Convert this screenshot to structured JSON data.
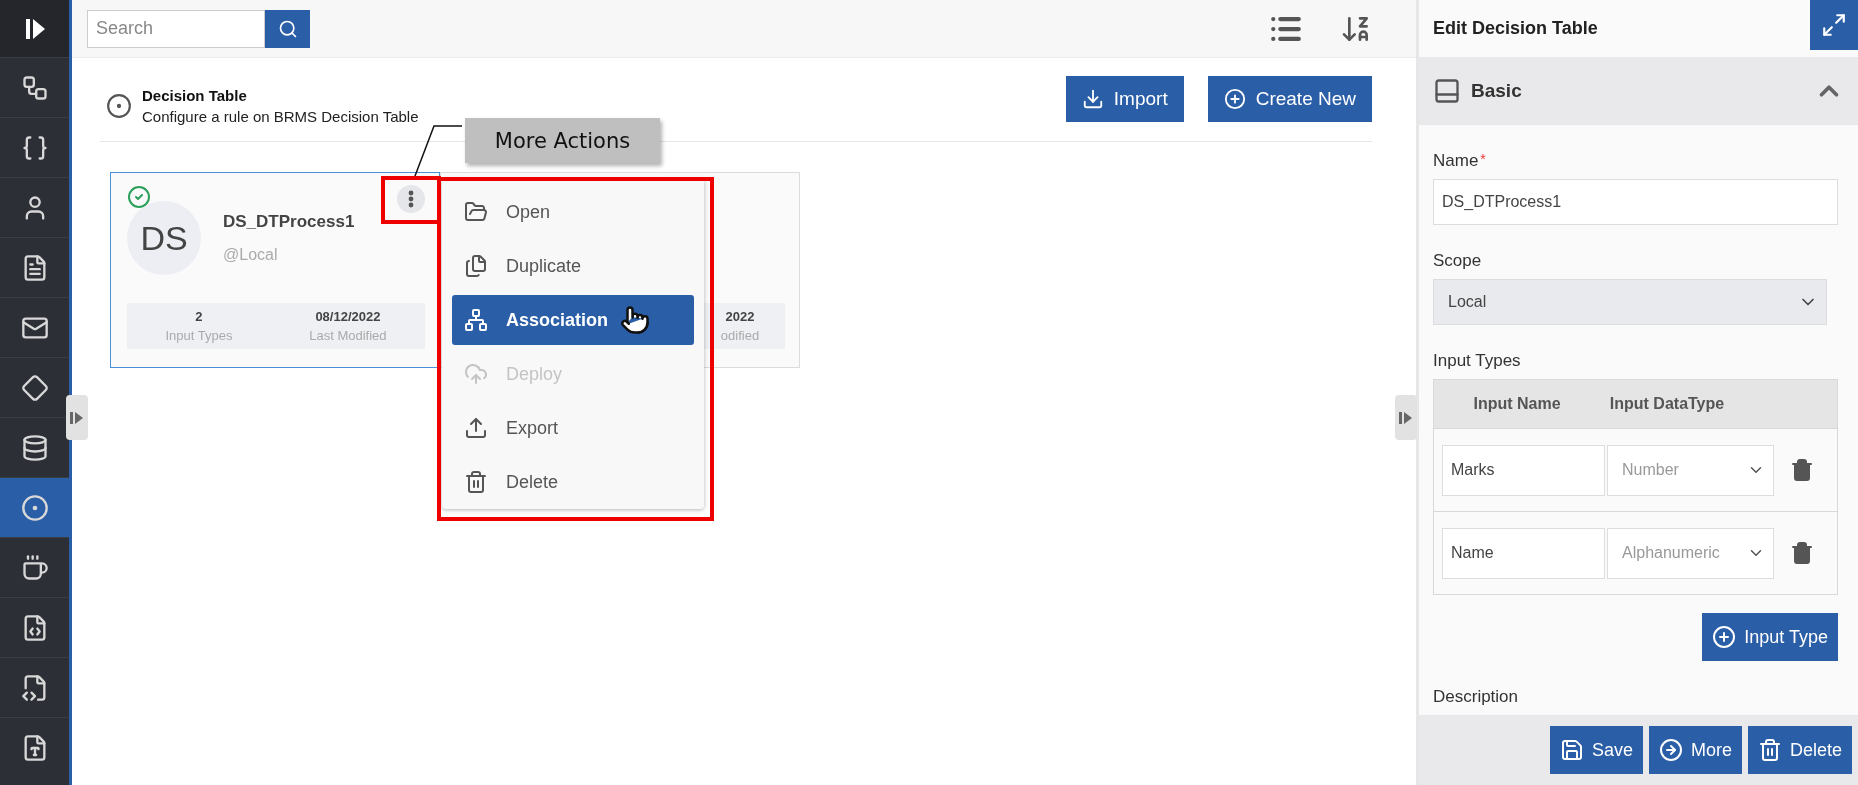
{
  "sidebar": {
    "items": [
      {
        "selected": false
      },
      {
        "selected": false
      },
      {
        "selected": false
      },
      {
        "selected": false
      },
      {
        "selected": false
      },
      {
        "selected": false
      },
      {
        "selected": false
      },
      {
        "selected": true
      },
      {
        "selected": false
      },
      {
        "selected": false
      },
      {
        "selected": false
      },
      {
        "selected": false
      }
    ]
  },
  "search": {
    "placeholder": "Search"
  },
  "header": {
    "title": "Decision Table",
    "subtitle": "Configure a rule on BRMS Decision Table"
  },
  "actions": [
    "Import",
    "Create New"
  ],
  "cards": [
    {
      "initials": "DS",
      "name": "DS_DTProcess1",
      "scope": "@Local",
      "valid": true,
      "selected": true,
      "stats": [
        {
          "value": "2",
          "label": "Input Types"
        },
        {
          "value": "08/12/2022",
          "label": "Last Modified"
        }
      ]
    },
    {
      "selected": false,
      "stats": [
        {
          "value": "2022",
          "label": "odified"
        }
      ]
    }
  ],
  "tooltip": "More Actions",
  "menu": {
    "items": [
      {
        "label": "Open",
        "selected": false,
        "disabled": false
      },
      {
        "label": "Duplicate",
        "selected": false,
        "disabled": false
      },
      {
        "label": "Association",
        "selected": true,
        "disabled": false
      },
      {
        "label": "Deploy",
        "selected": false,
        "disabled": true
      },
      {
        "label": "Export",
        "selected": false,
        "disabled": false
      },
      {
        "label": "Delete",
        "selected": false,
        "disabled": false
      }
    ]
  },
  "panel": {
    "title": "Edit Decision Table",
    "section": {
      "title": "Basic",
      "expanded": true
    },
    "name": {
      "label": "Name",
      "required_mark": "*",
      "value": "DS_DTProcess1"
    },
    "scope": {
      "label": "Scope",
      "value": "Local"
    },
    "input_types": {
      "label": "Input Types",
      "columns": [
        "Input Name",
        "Input DataType"
      ],
      "rows": [
        {
          "name": "Marks",
          "type": "Number"
        },
        {
          "name": "Name",
          "type": "Alphanumeric"
        }
      ],
      "add_button": "Input Type"
    },
    "description_label": "Description",
    "footer_buttons": [
      "Save",
      "More",
      "Delete"
    ]
  }
}
